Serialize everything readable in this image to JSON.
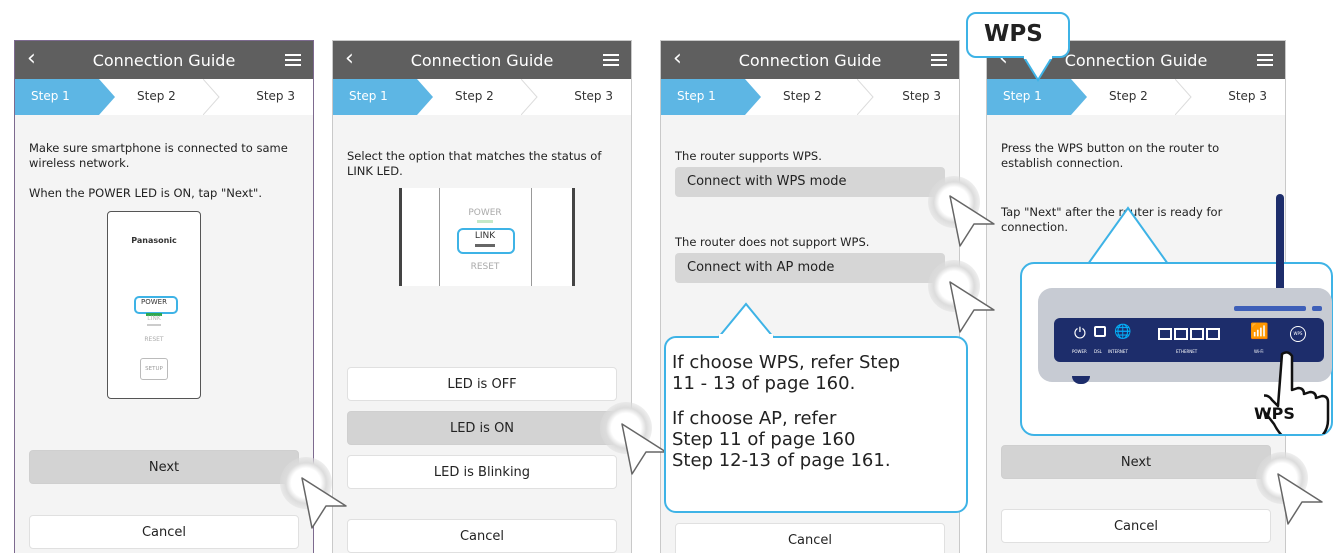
{
  "screens": [
    {
      "title": "Connection Guide",
      "steps": [
        "Step 1",
        "Step 2",
        "Step 3"
      ],
      "text1": "Make sure smartphone is connected to same wireless  network.",
      "text2": "When the POWER LED is ON, tap \"Next\".",
      "device": {
        "brand": "Panasonic",
        "power": "POWER",
        "link": "LINK",
        "reset": "RESET",
        "setup": "SETUP"
      },
      "next": "Next",
      "cancel": "Cancel"
    },
    {
      "title": "Connection Guide",
      "steps": [
        "Step 1",
        "Step 2",
        "Step 3"
      ],
      "text1": "Select the option that matches the status of LINK LED.",
      "device": {
        "power": "POWER",
        "link": "LINK",
        "reset": "RESET"
      },
      "options": [
        "LED is OFF",
        "LED is ON",
        "LED is Blinking"
      ],
      "cancel": "Cancel"
    },
    {
      "title": "Connection Guide",
      "steps": [
        "Step 1",
        "Step 2",
        "Step 3"
      ],
      "wps_text": "The router supports WPS.",
      "wps_button": "Connect with WPS mode",
      "ap_text": "The router does not support WPS.",
      "ap_button": "Connect with AP mode",
      "cancel": "Cancel"
    },
    {
      "title": "Connection Guide",
      "steps": [
        "Step 1",
        "Step 2",
        "Step 3"
      ],
      "text1": "Press the WPS button on the router to establish connection.",
      "text2": "Tap \"Next\" after the router is ready for connection.",
      "next": "Next",
      "cancel": "Cancel"
    }
  ],
  "callout_info": {
    "line1": "If choose WPS, refer Step",
    "line2": "11 - 13 of page 160.",
    "line3": "If choose AP, refer",
    "line4": "Step 11 of page 160",
    "line5": "Step 12-13 of page 161."
  },
  "wps_callout": "WPS",
  "router": {
    "labels": [
      "POWER",
      "DSL",
      "INTERNET",
      "ETHERNET",
      "Wi-Fi",
      "WPS"
    ],
    "wps_label": "WPS"
  },
  "colors": {
    "accent": "#5db6e4",
    "callout_border": "#3eb3e6",
    "appbar": "#5f5f5f",
    "router": "#1d2d6b"
  }
}
